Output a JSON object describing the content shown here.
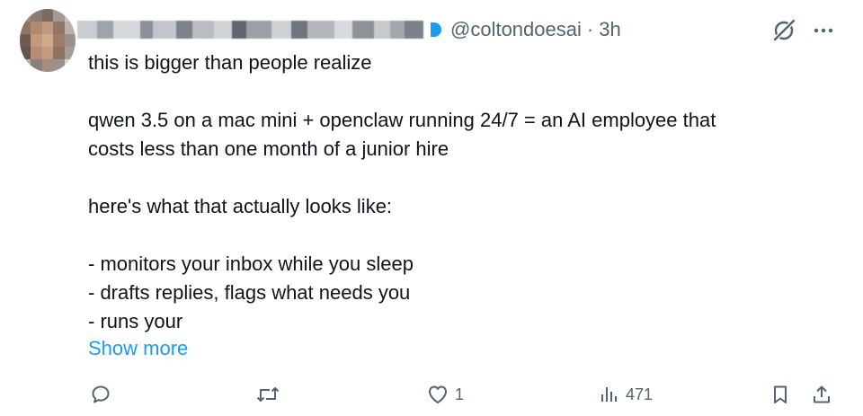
{
  "tweet": {
    "handle": "@coltondoesai",
    "separator": "·",
    "time": "3h",
    "lines": [
      "this is bigger than people realize",
      "",
      "qwen 3.5 on a mac mini + openclaw running 24/7 = an AI employee that",
      "costs less than one month of a junior hire",
      "",
      "here's what that actually looks like:",
      "",
      "- monitors your inbox while you sleep",
      "- drafts replies, flags what needs you",
      "- runs your"
    ],
    "show_more": "Show more"
  },
  "actions": {
    "reply_count": "",
    "retweet_count": "",
    "like_count": "1",
    "views_count": "471"
  },
  "icons": {
    "avatar": "avatar",
    "verified": "verified-badge-icon",
    "grok": "grok-icon",
    "more": "more-icon",
    "reply": "reply-icon",
    "retweet": "retweet-icon",
    "like": "heart-icon",
    "views": "views-icon",
    "bookmark": "bookmark-icon",
    "share": "share-icon"
  },
  "colors": {
    "text": "#0f1419",
    "muted": "#536471",
    "accent": "#1d9bf0"
  }
}
